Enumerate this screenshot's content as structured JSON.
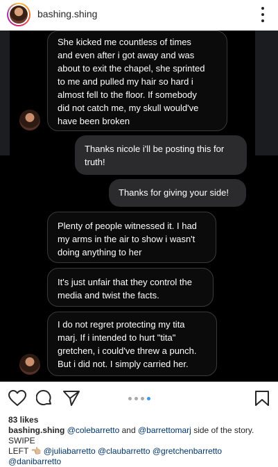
{
  "post": {
    "username": "bashing.shing",
    "likes": "83 likes",
    "caption": {
      "username": "bashing.shing",
      "mention_1": "@colebarretto",
      "and": "and",
      "mention_2": "@barrettomarj",
      "text_1": "side of the story. SWIPE",
      "text_2": "LEFT 👈🏼",
      "mentions_line": "@juliabarretto @claubarretto @gretchenbarretto @danibarretto"
    }
  },
  "messages": [
    {
      "type": "received",
      "text": "She kicked me countless of times\nand even after i got away and was\nabout to exit the chapel, she sprinted\nto me and pulled my hair so hard i\nalmost fell to the floor. If somebody\ndid not catch me, my skull would've\nhave been broken"
    },
    {
      "type": "sent",
      "text": "Thanks nicole i'll be posting this for\ntruth!"
    },
    {
      "type": "sent",
      "text": "Thanks for giving your side!"
    },
    {
      "type": "received",
      "text": "Plenty of people witnessed it. I had\nmy arms in the air to show i wasn't\ndoing anything to her"
    },
    {
      "type": "received",
      "text": "It's just unfair that they control the\nmedia and twist the facts."
    },
    {
      "type": "received",
      "text": "I do not regret protecting my tita\nmarj. If i intended to hurt \"tita\"\ngretchen, i could've threw a punch.\nBut i did not. I simply carried her."
    }
  ],
  "icons": {
    "more": "more-vertical-icon",
    "like": "heart-icon",
    "comment": "comment-icon",
    "share": "send-icon",
    "save": "bookmark-icon"
  },
  "carousel": {
    "total": 4,
    "active": 4
  },
  "colors": {
    "mention": "#003569",
    "active_dot": "#3897f0"
  }
}
